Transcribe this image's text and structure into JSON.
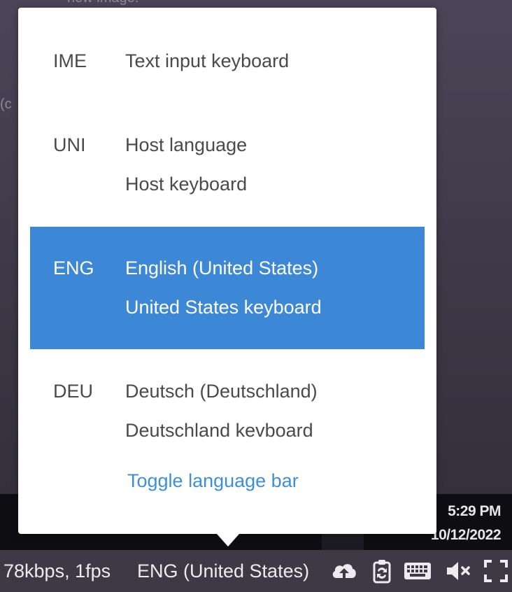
{
  "background": {
    "partial_text_top": "new image.",
    "partial_text_left": "(c"
  },
  "taskbar": {
    "time": "5:29 PM",
    "date": "10/12/2022"
  },
  "popup": {
    "languages": [
      {
        "code": "IME",
        "lines": [
          "Text input keyboard"
        ],
        "selected": false
      },
      {
        "code": "UNI",
        "lines": [
          "Host language",
          "Host keyboard"
        ],
        "selected": false
      },
      {
        "code": "ENG",
        "lines": [
          "English (United States)",
          "United States keyboard"
        ],
        "selected": true
      },
      {
        "code": "DEU",
        "lines": [
          "Deutsch (Deutschland)",
          "Deutschland kevboard"
        ],
        "selected": false
      }
    ],
    "toggle_label": "Toggle language bar",
    "selected_color": "#3c87d6",
    "link_color": "#3d8fdc"
  },
  "statusbar": {
    "bandwidth": "78kbps, 1fps",
    "language": "ENG (United States)",
    "icons": [
      "cloud-upload-icon",
      "clipboard-sync-icon",
      "keyboard-icon",
      "mute-icon",
      "fullscreen-icon"
    ]
  }
}
